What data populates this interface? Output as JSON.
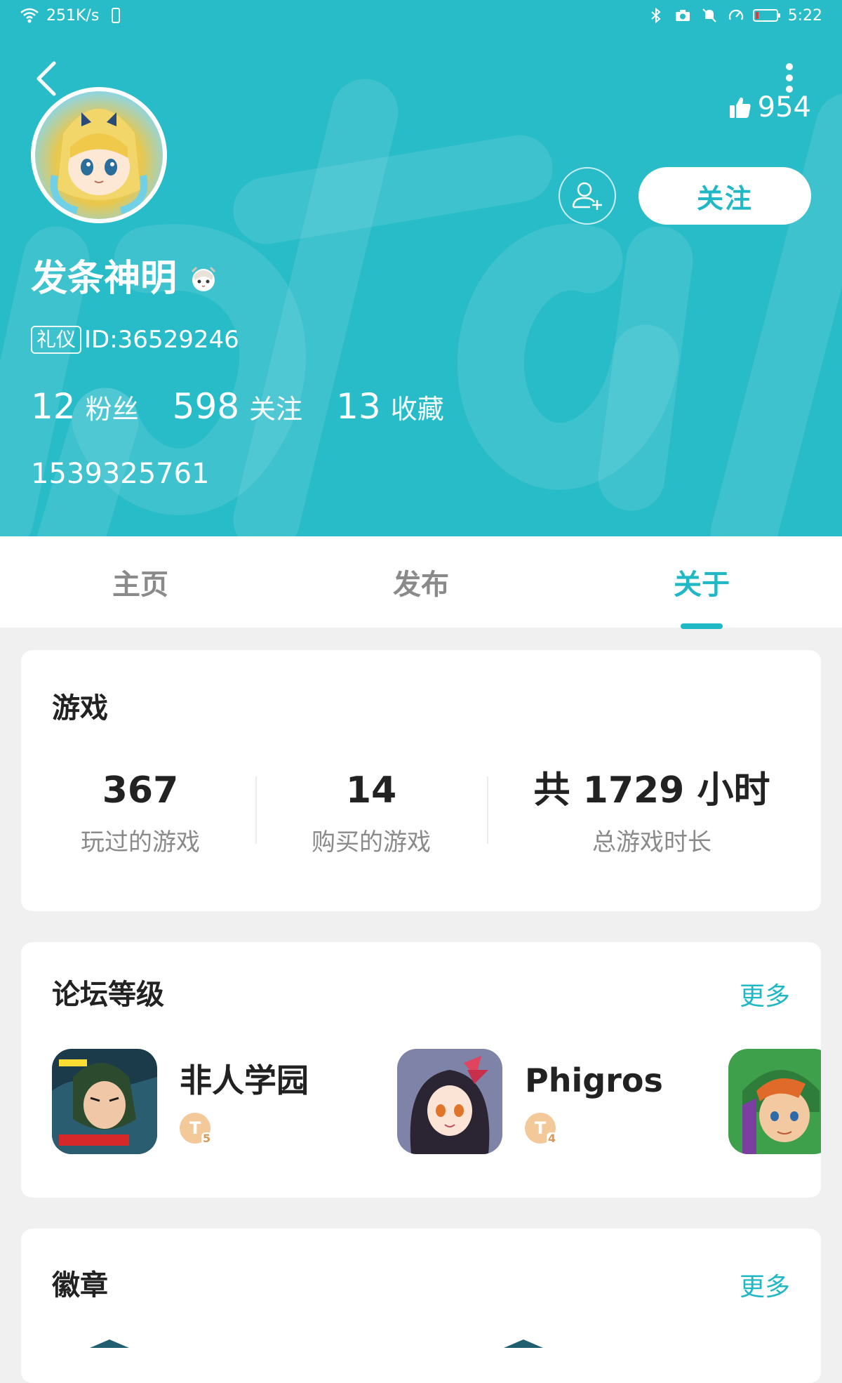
{
  "status_bar": {
    "network_speed": "251K/s",
    "time": "5:22",
    "icons": [
      "wifi-icon",
      "vibrate-icon",
      "bluetooth-icon",
      "camera-icon",
      "mute-icon",
      "data-saver-icon",
      "battery-icon"
    ]
  },
  "header": {
    "likes_count": "954",
    "follow_label": "关注",
    "background_color": "#28bcc9"
  },
  "profile": {
    "username": "发条神明",
    "tag": "礼仪",
    "id_text": "ID:36529246",
    "stats": [
      {
        "value": "12",
        "label": "粉丝"
      },
      {
        "value": "598",
        "label": "关注"
      },
      {
        "value": "13",
        "label": "收藏"
      }
    ],
    "extra_number": "1539325761"
  },
  "tabs": [
    {
      "label": "主页",
      "active": false
    },
    {
      "label": "发布",
      "active": false
    },
    {
      "label": "关于",
      "active": true
    }
  ],
  "games_section": {
    "title": "游戏",
    "stats": [
      {
        "value": "367",
        "label": "玩过的游戏"
      },
      {
        "value": "14",
        "label": "购买的游戏"
      },
      {
        "value": "共 1729 小时",
        "label": "总游戏时长"
      }
    ]
  },
  "forum_section": {
    "title": "论坛等级",
    "more": "更多",
    "items": [
      {
        "name": "非人学园",
        "badge": "T",
        "level": "5"
      },
      {
        "name": "Phigros",
        "badge": "T",
        "level": "4"
      }
    ]
  },
  "badges_section": {
    "title": "徽章",
    "more": "更多"
  },
  "colors": {
    "accent": "#21b8c6",
    "text_primary": "#222222",
    "text_secondary": "#8a8a8a"
  }
}
